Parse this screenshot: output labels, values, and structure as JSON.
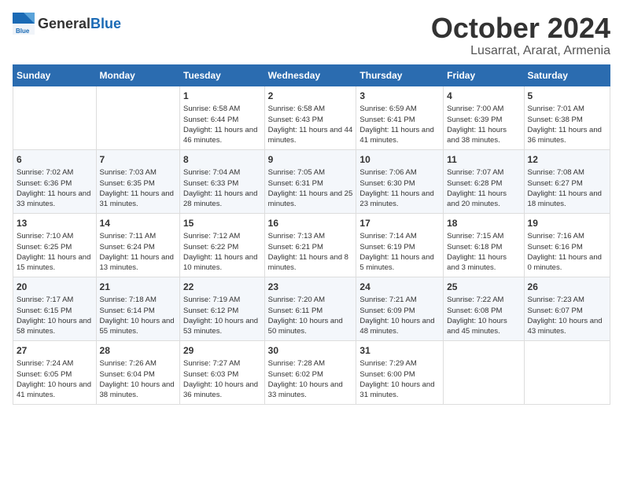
{
  "logo": {
    "general": "General",
    "blue": "Blue"
  },
  "header": {
    "month": "October 2024",
    "location": "Lusarrat, Ararat, Armenia"
  },
  "days_of_week": [
    "Sunday",
    "Monday",
    "Tuesday",
    "Wednesday",
    "Thursday",
    "Friday",
    "Saturday"
  ],
  "weeks": [
    [
      {
        "day": "",
        "sunrise": "",
        "sunset": "",
        "daylight": ""
      },
      {
        "day": "",
        "sunrise": "",
        "sunset": "",
        "daylight": ""
      },
      {
        "day": "1",
        "sunrise": "Sunrise: 6:58 AM",
        "sunset": "Sunset: 6:44 PM",
        "daylight": "Daylight: 11 hours and 46 minutes."
      },
      {
        "day": "2",
        "sunrise": "Sunrise: 6:58 AM",
        "sunset": "Sunset: 6:43 PM",
        "daylight": "Daylight: 11 hours and 44 minutes."
      },
      {
        "day": "3",
        "sunrise": "Sunrise: 6:59 AM",
        "sunset": "Sunset: 6:41 PM",
        "daylight": "Daylight: 11 hours and 41 minutes."
      },
      {
        "day": "4",
        "sunrise": "Sunrise: 7:00 AM",
        "sunset": "Sunset: 6:39 PM",
        "daylight": "Daylight: 11 hours and 38 minutes."
      },
      {
        "day": "5",
        "sunrise": "Sunrise: 7:01 AM",
        "sunset": "Sunset: 6:38 PM",
        "daylight": "Daylight: 11 hours and 36 minutes."
      }
    ],
    [
      {
        "day": "6",
        "sunrise": "Sunrise: 7:02 AM",
        "sunset": "Sunset: 6:36 PM",
        "daylight": "Daylight: 11 hours and 33 minutes."
      },
      {
        "day": "7",
        "sunrise": "Sunrise: 7:03 AM",
        "sunset": "Sunset: 6:35 PM",
        "daylight": "Daylight: 11 hours and 31 minutes."
      },
      {
        "day": "8",
        "sunrise": "Sunrise: 7:04 AM",
        "sunset": "Sunset: 6:33 PM",
        "daylight": "Daylight: 11 hours and 28 minutes."
      },
      {
        "day": "9",
        "sunrise": "Sunrise: 7:05 AM",
        "sunset": "Sunset: 6:31 PM",
        "daylight": "Daylight: 11 hours and 25 minutes."
      },
      {
        "day": "10",
        "sunrise": "Sunrise: 7:06 AM",
        "sunset": "Sunset: 6:30 PM",
        "daylight": "Daylight: 11 hours and 23 minutes."
      },
      {
        "day": "11",
        "sunrise": "Sunrise: 7:07 AM",
        "sunset": "Sunset: 6:28 PM",
        "daylight": "Daylight: 11 hours and 20 minutes."
      },
      {
        "day": "12",
        "sunrise": "Sunrise: 7:08 AM",
        "sunset": "Sunset: 6:27 PM",
        "daylight": "Daylight: 11 hours and 18 minutes."
      }
    ],
    [
      {
        "day": "13",
        "sunrise": "Sunrise: 7:10 AM",
        "sunset": "Sunset: 6:25 PM",
        "daylight": "Daylight: 11 hours and 15 minutes."
      },
      {
        "day": "14",
        "sunrise": "Sunrise: 7:11 AM",
        "sunset": "Sunset: 6:24 PM",
        "daylight": "Daylight: 11 hours and 13 minutes."
      },
      {
        "day": "15",
        "sunrise": "Sunrise: 7:12 AM",
        "sunset": "Sunset: 6:22 PM",
        "daylight": "Daylight: 11 hours and 10 minutes."
      },
      {
        "day": "16",
        "sunrise": "Sunrise: 7:13 AM",
        "sunset": "Sunset: 6:21 PM",
        "daylight": "Daylight: 11 hours and 8 minutes."
      },
      {
        "day": "17",
        "sunrise": "Sunrise: 7:14 AM",
        "sunset": "Sunset: 6:19 PM",
        "daylight": "Daylight: 11 hours and 5 minutes."
      },
      {
        "day": "18",
        "sunrise": "Sunrise: 7:15 AM",
        "sunset": "Sunset: 6:18 PM",
        "daylight": "Daylight: 11 hours and 3 minutes."
      },
      {
        "day": "19",
        "sunrise": "Sunrise: 7:16 AM",
        "sunset": "Sunset: 6:16 PM",
        "daylight": "Daylight: 11 hours and 0 minutes."
      }
    ],
    [
      {
        "day": "20",
        "sunrise": "Sunrise: 7:17 AM",
        "sunset": "Sunset: 6:15 PM",
        "daylight": "Daylight: 10 hours and 58 minutes."
      },
      {
        "day": "21",
        "sunrise": "Sunrise: 7:18 AM",
        "sunset": "Sunset: 6:14 PM",
        "daylight": "Daylight: 10 hours and 55 minutes."
      },
      {
        "day": "22",
        "sunrise": "Sunrise: 7:19 AM",
        "sunset": "Sunset: 6:12 PM",
        "daylight": "Daylight: 10 hours and 53 minutes."
      },
      {
        "day": "23",
        "sunrise": "Sunrise: 7:20 AM",
        "sunset": "Sunset: 6:11 PM",
        "daylight": "Daylight: 10 hours and 50 minutes."
      },
      {
        "day": "24",
        "sunrise": "Sunrise: 7:21 AM",
        "sunset": "Sunset: 6:09 PM",
        "daylight": "Daylight: 10 hours and 48 minutes."
      },
      {
        "day": "25",
        "sunrise": "Sunrise: 7:22 AM",
        "sunset": "Sunset: 6:08 PM",
        "daylight": "Daylight: 10 hours and 45 minutes."
      },
      {
        "day": "26",
        "sunrise": "Sunrise: 7:23 AM",
        "sunset": "Sunset: 6:07 PM",
        "daylight": "Daylight: 10 hours and 43 minutes."
      }
    ],
    [
      {
        "day": "27",
        "sunrise": "Sunrise: 7:24 AM",
        "sunset": "Sunset: 6:05 PM",
        "daylight": "Daylight: 10 hours and 41 minutes."
      },
      {
        "day": "28",
        "sunrise": "Sunrise: 7:26 AM",
        "sunset": "Sunset: 6:04 PM",
        "daylight": "Daylight: 10 hours and 38 minutes."
      },
      {
        "day": "29",
        "sunrise": "Sunrise: 7:27 AM",
        "sunset": "Sunset: 6:03 PM",
        "daylight": "Daylight: 10 hours and 36 minutes."
      },
      {
        "day": "30",
        "sunrise": "Sunrise: 7:28 AM",
        "sunset": "Sunset: 6:02 PM",
        "daylight": "Daylight: 10 hours and 33 minutes."
      },
      {
        "day": "31",
        "sunrise": "Sunrise: 7:29 AM",
        "sunset": "Sunset: 6:00 PM",
        "daylight": "Daylight: 10 hours and 31 minutes."
      },
      {
        "day": "",
        "sunrise": "",
        "sunset": "",
        "daylight": ""
      },
      {
        "day": "",
        "sunrise": "",
        "sunset": "",
        "daylight": ""
      }
    ]
  ]
}
